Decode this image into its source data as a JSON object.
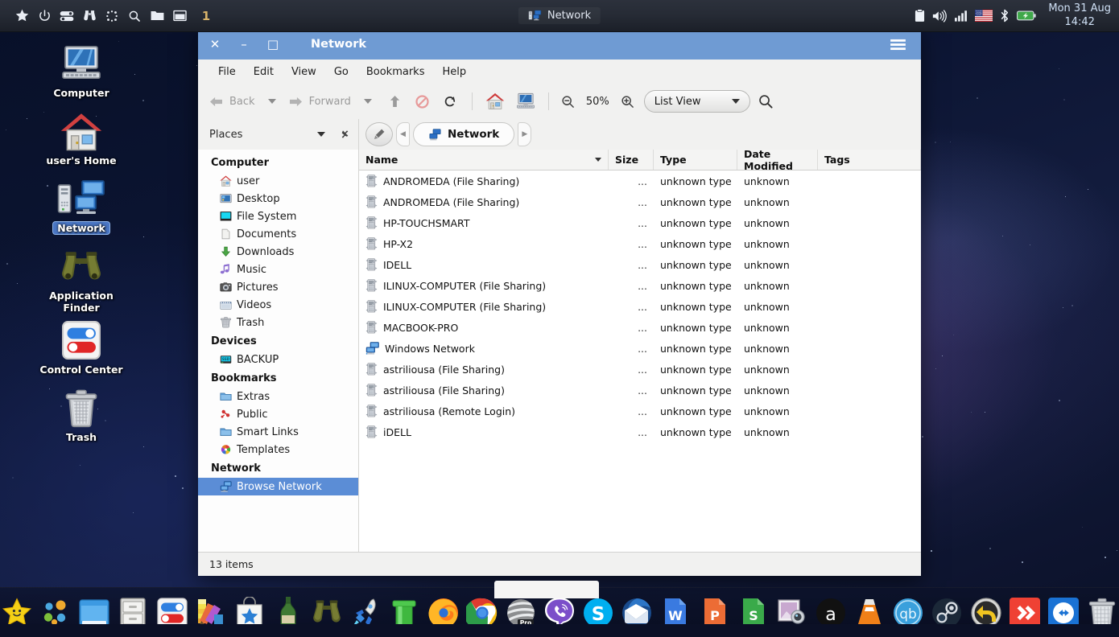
{
  "top_panel": {
    "left_icons": [
      {
        "name": "star-icon",
        "glyph": "★"
      },
      {
        "name": "power-icon",
        "glyph": "⏻"
      },
      {
        "name": "toggle-icon",
        "glyph": "⚙"
      },
      {
        "name": "binoculars-icon",
        "glyph": "🔭"
      },
      {
        "name": "grid-dots-icon",
        "glyph": "⣿"
      },
      {
        "name": "search-icon",
        "glyph": "🔍"
      },
      {
        "name": "folder-icon",
        "glyph": "📁"
      },
      {
        "name": "window-icon",
        "glyph": "🗖"
      }
    ],
    "workspace": "1",
    "window_title": "Network",
    "tray": [
      {
        "name": "clipboard-icon"
      },
      {
        "name": "volume-icon"
      },
      {
        "name": "signal-icon"
      },
      {
        "name": "keyboard-layout-flag-icon",
        "label": "US"
      },
      {
        "name": "bluetooth-icon"
      },
      {
        "name": "battery-icon"
      }
    ],
    "clock_date": "Mon 31 Aug",
    "clock_time": "14:42"
  },
  "desktop_icons": [
    {
      "label": "Computer",
      "icon": "computer-icon",
      "selected": false
    },
    {
      "label": "user's Home",
      "icon": "home-icon",
      "selected": false
    },
    {
      "label": "Network",
      "icon": "network-icon",
      "selected": true
    },
    {
      "label": "Application Finder",
      "icon": "binoculars-icon",
      "selected": false
    },
    {
      "label": "Control Center",
      "icon": "control-center-icon",
      "selected": false
    },
    {
      "label": "Trash",
      "icon": "trash-icon",
      "selected": false
    }
  ],
  "window": {
    "title": "Network",
    "titlebar_color": "#6f9bd3",
    "close_label": "✕",
    "minimize_label": "–",
    "maximize_label": "□",
    "menu_label": "☰",
    "menubar": [
      "File",
      "Edit",
      "View",
      "Go",
      "Bookmarks",
      "Help"
    ],
    "toolbar": {
      "back_label": "Back",
      "forward_label": "Forward",
      "up_name": "up-icon",
      "stop_name": "stop-icon",
      "reload_name": "reload-icon",
      "home_name": "home-icon",
      "computer_name": "computer-icon",
      "zoom_out_name": "zoom-out-icon",
      "zoom_level": "50%",
      "zoom_in_name": "zoom-in-icon",
      "view_mode": "List View",
      "search_name": "search-icon"
    },
    "sidebar_header": {
      "title": "Places",
      "dropdown_name": "chevron-down-icon",
      "close_name": "close-icon"
    },
    "pathbar": {
      "edit_path_name": "pencil-icon",
      "prev_name": "chevron-left-icon",
      "next_name": "chevron-right-icon",
      "crumb": "Network"
    },
    "sidebar": {
      "groups": [
        {
          "title": "Computer",
          "items": [
            {
              "label": "user",
              "icon": "home-icon"
            },
            {
              "label": "Desktop",
              "icon": "desktop-icon"
            },
            {
              "label": "File System",
              "icon": "filesystem-icon"
            },
            {
              "label": "Documents",
              "icon": "documents-icon"
            },
            {
              "label": "Downloads",
              "icon": "downloads-icon"
            },
            {
              "label": "Music",
              "icon": "music-icon"
            },
            {
              "label": "Pictures",
              "icon": "pictures-icon"
            },
            {
              "label": "Videos",
              "icon": "videos-icon"
            },
            {
              "label": "Trash",
              "icon": "trash-icon"
            }
          ]
        },
        {
          "title": "Devices",
          "items": [
            {
              "label": "BACKUP",
              "icon": "drive-icon"
            }
          ]
        },
        {
          "title": "Bookmarks",
          "items": [
            {
              "label": "Extras",
              "icon": "folder-icon"
            },
            {
              "label": "Public",
              "icon": "public-folder-icon"
            },
            {
              "label": "Smart Links",
              "icon": "folder-icon"
            },
            {
              "label": "Templates",
              "icon": "templates-icon"
            }
          ]
        },
        {
          "title": "Network",
          "items": [
            {
              "label": "Browse Network",
              "icon": "network-icon",
              "active": true
            }
          ]
        }
      ]
    },
    "file_list": {
      "columns": [
        "Name",
        "Size",
        "Type",
        "Date Modified",
        "Tags"
      ],
      "sorted_column": "Name",
      "rows": [
        {
          "name": "ANDROMEDA (File Sharing)",
          "size": "...",
          "type": "unknown type",
          "modified": "unknown",
          "tags": "",
          "icon": "server-icon"
        },
        {
          "name": "ANDROMEDA (File Sharing)",
          "size": "...",
          "type": "unknown type",
          "modified": "unknown",
          "tags": "",
          "icon": "server-icon"
        },
        {
          "name": "HP-TOUCHSMART",
          "size": "...",
          "type": "unknown type",
          "modified": "unknown",
          "tags": "",
          "icon": "server-icon"
        },
        {
          "name": "HP-X2",
          "size": "...",
          "type": "unknown type",
          "modified": "unknown",
          "tags": "",
          "icon": "server-icon"
        },
        {
          "name": "IDELL",
          "size": "...",
          "type": "unknown type",
          "modified": "unknown",
          "tags": "",
          "icon": "server-icon"
        },
        {
          "name": "ILINUX-COMPUTER (File Sharing)",
          "size": "...",
          "type": "unknown type",
          "modified": "unknown",
          "tags": "",
          "icon": "server-icon"
        },
        {
          "name": "ILINUX-COMPUTER (File Sharing)",
          "size": "...",
          "type": "unknown type",
          "modified": "unknown",
          "tags": "",
          "icon": "server-icon"
        },
        {
          "name": "MACBOOK-PRO",
          "size": "...",
          "type": "unknown type",
          "modified": "unknown",
          "tags": "",
          "icon": "server-icon"
        },
        {
          "name": "Windows Network",
          "size": "...",
          "type": "unknown type",
          "modified": "unknown",
          "tags": "",
          "icon": "network-icon"
        },
        {
          "name": "astriliousa (File Sharing)",
          "size": "...",
          "type": "unknown type",
          "modified": "unknown",
          "tags": "",
          "icon": "server-icon"
        },
        {
          "name": "astriliousa (File Sharing)",
          "size": "...",
          "type": "unknown type",
          "modified": "unknown",
          "tags": "",
          "icon": "server-icon"
        },
        {
          "name": "astriliousa (Remote Login)",
          "size": "...",
          "type": "unknown type",
          "modified": "unknown",
          "tags": "",
          "icon": "server-icon"
        },
        {
          "name": "iDELL",
          "size": "...",
          "type": "unknown type",
          "modified": "unknown",
          "tags": "",
          "icon": "server-icon"
        }
      ]
    },
    "status": "13 items"
  },
  "dock": {
    "items": [
      {
        "name": "smiley-star-icon"
      },
      {
        "name": "dots-launcher-icon"
      },
      {
        "name": "file-manager-icon"
      },
      {
        "name": "catfish-cabinet-icon"
      },
      {
        "name": "control-center-icon"
      },
      {
        "name": "color-palette-icon"
      },
      {
        "name": "software-store-icon"
      },
      {
        "name": "bottle-icon"
      },
      {
        "name": "binoculars-icon"
      },
      {
        "name": "rocket-icon"
      },
      {
        "name": "green-pipe-icon"
      },
      {
        "name": "firefox-icon"
      },
      {
        "name": "chrome-icon"
      },
      {
        "name": "pro-sphere-icon"
      },
      {
        "name": "viber-icon"
      },
      {
        "name": "skype-icon"
      },
      {
        "name": "thunderbird-icon"
      },
      {
        "name": "writer-icon"
      },
      {
        "name": "impress-icon"
      },
      {
        "name": "calc-icon"
      },
      {
        "name": "screenshot-icon"
      },
      {
        "name": "audacious-icon"
      },
      {
        "name": "vlc-icon"
      },
      {
        "name": "qbittorrent-icon"
      },
      {
        "name": "steam-icon"
      },
      {
        "name": "undo-icon"
      },
      {
        "name": "anydesk-icon"
      },
      {
        "name": "teamviewer-icon"
      },
      {
        "name": "trash-icon"
      }
    ]
  }
}
